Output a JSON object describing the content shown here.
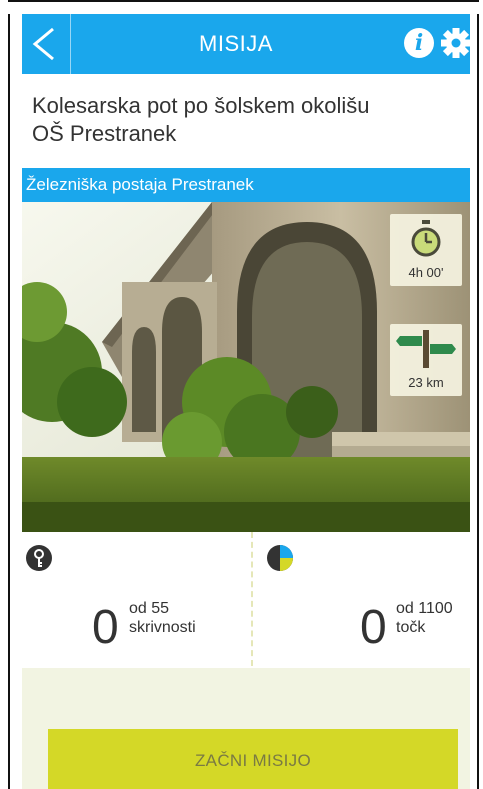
{
  "header": {
    "title": "MISIJA",
    "back_icon": "chevron-left-icon",
    "info_icon": "info-icon",
    "settings_icon": "gear-icon"
  },
  "mission": {
    "title_line1": "Kolesarska pot po šolskem okolišu",
    "title_line2": "OŠ Prestranek",
    "location": "Železniška postaja Prestranek"
  },
  "badges": {
    "duration": "4h 00'",
    "distance": "23 km"
  },
  "stats": {
    "secrets_value": "0",
    "secrets_total": "od 55",
    "secrets_label": "skrivnosti",
    "points_value": "0",
    "points_total": "od 1100",
    "points_label": "točk"
  },
  "actions": {
    "start_label": "ZAČNI MISIJO"
  },
  "colors": {
    "accent": "#1aa7ec",
    "button": "#d4d827",
    "bottom_bg": "#f2f4e2"
  }
}
